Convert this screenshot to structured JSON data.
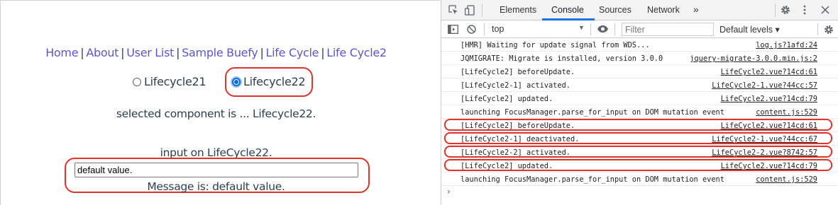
{
  "nav": {
    "links": [
      "Home",
      "About",
      "User List",
      "Sample Buefy",
      "Life Cycle",
      "Life Cycle2"
    ],
    "separator": "|"
  },
  "radios": [
    {
      "label": "Lifecycle21",
      "checked": false
    },
    {
      "label": "Lifecycle22",
      "checked": true
    }
  ],
  "selected_text": "selected component is ... Lifecycle22.",
  "input_label": "input on LifeCycle22.",
  "input_value": "default value.",
  "message": "Message is: default value.",
  "devtools": {
    "tabs": [
      "Elements",
      "Console",
      "Sources",
      "Network"
    ],
    "active_tab": "Console",
    "more_tabs": "»",
    "context": "top",
    "filter_placeholder": "Filter",
    "levels": "Default levels ▾",
    "prompt": "›",
    "icons": {
      "inspect": "inspect-icon",
      "device": "device-toggle-icon",
      "settings": "gear-icon",
      "menu": "kebab-menu-icon",
      "close": "close-icon",
      "sidebar": "sidebar-toggle-icon",
      "clear": "clear-console-icon",
      "eye": "live-expression-icon"
    },
    "logs": [
      {
        "msg": "[HMR] Waiting for update signal from WDS...",
        "src": "log.js?1afd:24",
        "highlight": false
      },
      {
        "msg": "JQMIGRATE: Migrate is installed, version 3.0.0",
        "src": "jquery-migrate-3.0.0.min.js:2",
        "highlight": false
      },
      {
        "msg": "[LifeCycle2] beforeUpdate.",
        "src": "LifeCycle2.vue?14cd:61",
        "highlight": false
      },
      {
        "msg": "[LifeCycle2-1] activated.",
        "src": "LifeCycle2-1.vue?44cc:57",
        "highlight": false
      },
      {
        "msg": "[LifeCycle2] updated.",
        "src": "LifeCycle2.vue?14cd:79",
        "highlight": false
      },
      {
        "msg": "launching FocusManager.parse_for_input on DOM mutation event",
        "src": "content.js:529",
        "highlight": false
      },
      {
        "msg": "[LifeCycle2] beforeUpdate.",
        "src": "LifeCycle2.vue?14cd:61",
        "highlight": true
      },
      {
        "msg": "[LifeCycle2-1] deactivated.",
        "src": "LifeCycle2-1.vue?44cc:67",
        "highlight": true
      },
      {
        "msg": "[LifeCycle2-2] activated.",
        "src": "LifeCycle2-2.vue?8742:57",
        "highlight": true
      },
      {
        "msg": "[LifeCycle2] updated.",
        "src": "LifeCycle2.vue?14cd:79",
        "highlight": true
      },
      {
        "msg": "launching FocusManager.parse_for_input on DOM mutation event",
        "src": "content.js:529",
        "highlight": false
      }
    ]
  },
  "colors": {
    "link": "#5b57c9",
    "annotation_ring": "#e0332b",
    "devtools_accent": "#1a73e8"
  }
}
